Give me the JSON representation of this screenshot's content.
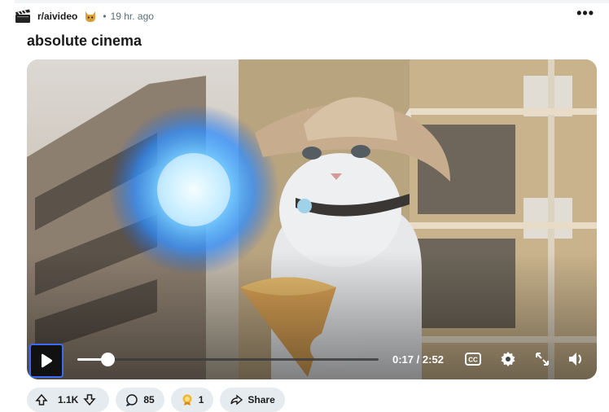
{
  "post": {
    "subreddit": "r/aivideo",
    "subreddit_icon": "clapperboard-icon",
    "flair_icon": "cat-emoji-icon",
    "separator": "•",
    "time_ago": "19 hr. ago",
    "more_label": "•••",
    "title": "absolute cinema"
  },
  "player": {
    "progress": 0.1,
    "current_time": "0:17",
    "duration": "2:52",
    "time_separator": "/",
    "icons": [
      "play-icon",
      "captions-icon",
      "settings-icon",
      "fullscreen-icon",
      "volume-icon"
    ]
  },
  "actions": {
    "upvotes": "1.1K",
    "comments": "85",
    "awards": "1",
    "share_label": "Share"
  },
  "colors": {
    "focus_ring": "#3b6bf5",
    "pill_bg": "#e5ebee",
    "meta_text": "#576f76"
  }
}
